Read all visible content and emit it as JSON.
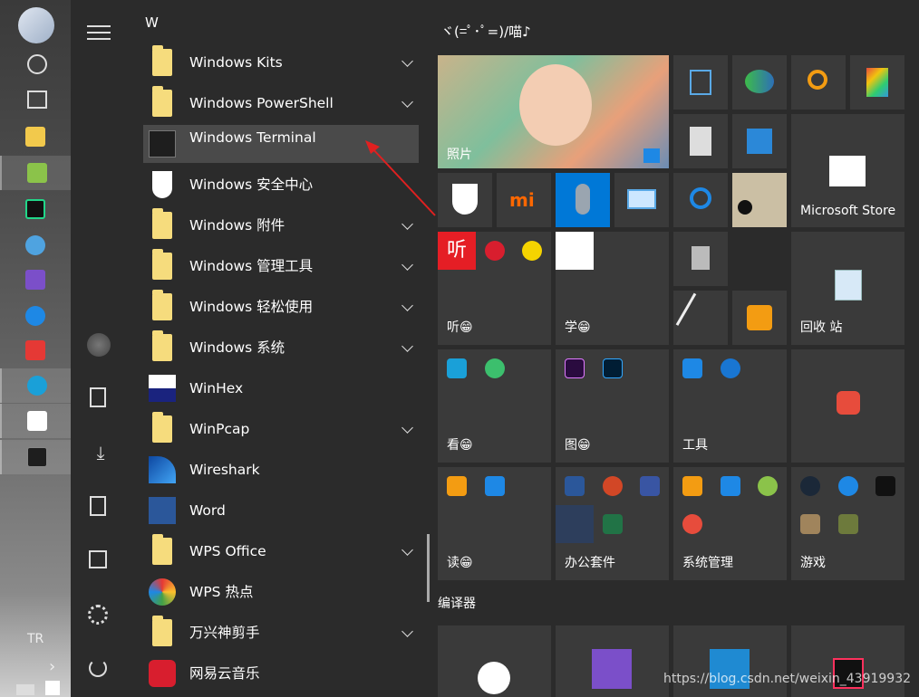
{
  "app_list": {
    "section_letter": "W",
    "items": [
      {
        "label": "Windows Kits",
        "icon": "folder-icon",
        "expandable": true
      },
      {
        "label": "Windows PowerShell",
        "icon": "folder-icon",
        "expandable": true
      },
      {
        "label": "Windows Terminal",
        "icon": "terminal-icon",
        "expandable": false
      },
      {
        "label": "Windows 安全中心",
        "icon": "shield-icon",
        "expandable": false
      },
      {
        "label": "Windows 附件",
        "icon": "folder-icon",
        "expandable": true
      },
      {
        "label": "Windows 管理工具",
        "icon": "folder-icon",
        "expandable": true
      },
      {
        "label": "Windows 轻松使用",
        "icon": "folder-icon",
        "expandable": true
      },
      {
        "label": "Windows 系统",
        "icon": "folder-icon",
        "expandable": true
      },
      {
        "label": "WinHex",
        "icon": "winhex-icon",
        "expandable": false
      },
      {
        "label": "WinPcap",
        "icon": "folder-icon",
        "expandable": true
      },
      {
        "label": "Wireshark",
        "icon": "wireshark-icon",
        "expandable": false
      },
      {
        "label": "Word",
        "icon": "word-icon",
        "expandable": false
      },
      {
        "label": "WPS Office",
        "icon": "folder-icon",
        "expandable": true
      },
      {
        "label": "WPS 热点",
        "icon": "wps-hotspot-icon",
        "expandable": false
      },
      {
        "label": "万兴神剪手",
        "icon": "folder-icon",
        "expandable": true
      },
      {
        "label": "网易云音乐",
        "icon": "netease-music-icon",
        "expandable": false
      }
    ]
  },
  "tiles": {
    "top_group_title": "ヾ(=ﾟ･ﾟ=)/喵♪",
    "photos_label": "照片",
    "store_label": "Microsoft Store",
    "recycle_label": "回收 站",
    "listen_label": "听😁",
    "learn_label": "学😁",
    "watch_label": "看😁",
    "picture_label": "图😁",
    "tools_label": "工具",
    "read_label": "读😁",
    "office_label": "办公套件",
    "sysmgr_label": "系统管理",
    "games_label": "游戏",
    "editor_group_title": "编译器",
    "ting_text": "听"
  },
  "taskbar": {
    "language": "TR"
  },
  "watermark": "https://blog.csdn.net/weixin_43919932",
  "colors": {
    "accent_blue": "#0078d7",
    "arrow_red": "#e02020",
    "folder_yellow": "#f6dc7d"
  }
}
